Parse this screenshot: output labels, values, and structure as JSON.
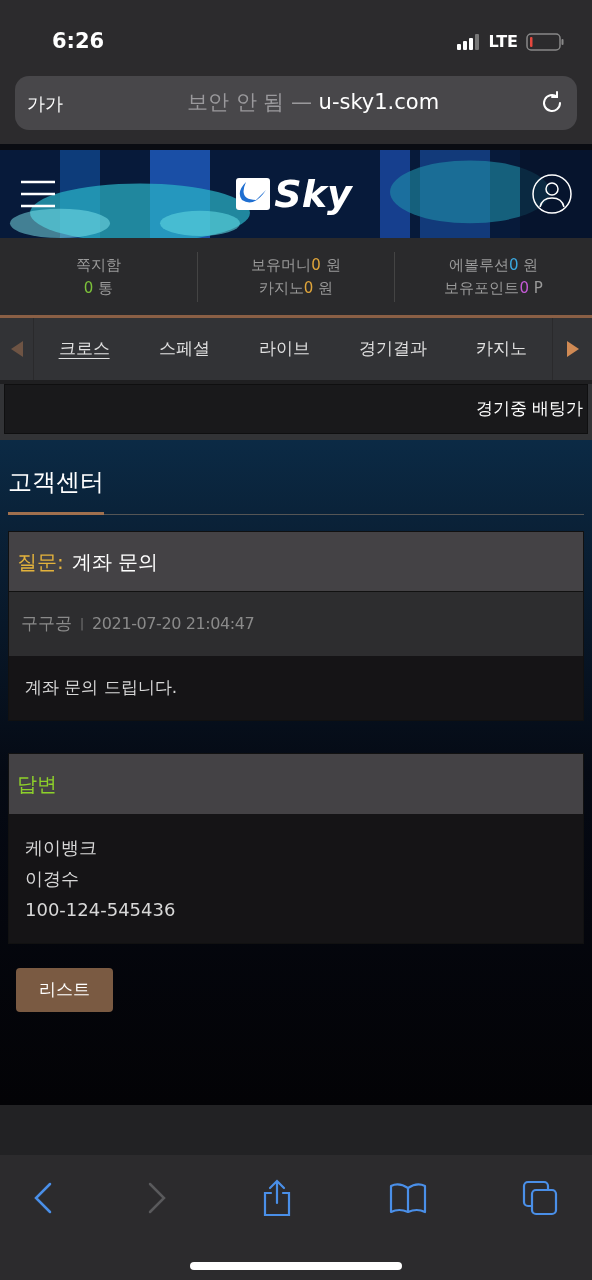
{
  "status_bar": {
    "time": "6:26",
    "network": "LTE"
  },
  "address_bar": {
    "text_size": "가가",
    "security": "보안 안 됨 —",
    "domain": "u-sky1.com"
  },
  "header": {
    "logo": "Sky"
  },
  "stats": [
    {
      "label": "쪽지함",
      "lines": [
        {
          "value": "0",
          "unit": "통",
          "color": "#7cc13a"
        }
      ]
    },
    {
      "lines": [
        {
          "name": "보유머니",
          "value": "0",
          "unit": "원",
          "color": "#e0a53a"
        },
        {
          "name": "카지노",
          "value": "0",
          "unit": "원",
          "color": "#e0a53a"
        }
      ]
    },
    {
      "lines": [
        {
          "name": "에볼루션",
          "value": "0",
          "unit": "원",
          "color": "#3aa8e0"
        },
        {
          "name": "보유포인트",
          "value": "0",
          "unit": "P",
          "color": "#c45ad6"
        }
      ]
    }
  ],
  "nav": {
    "tabs": [
      {
        "label": "크로스",
        "selected": true
      },
      {
        "label": "스페셜",
        "selected": false
      },
      {
        "label": "라이브",
        "selected": false
      },
      {
        "label": "경기결과",
        "selected": false
      },
      {
        "label": "카지노",
        "selected": false
      }
    ]
  },
  "ticker": "경기중 배팅가",
  "page_title": "고객센터",
  "question": {
    "label": "질문:",
    "title": "계좌 문의",
    "author": "구구공",
    "separator": "|",
    "date": "2021-07-20 21:04:47",
    "body": "계좌 문의 드립니다."
  },
  "answer": {
    "label": "답변",
    "lines": [
      "케이뱅크",
      "이경수",
      "100-124-545436"
    ]
  },
  "list_button": "리스트",
  "toolbar": {
    "back_disabled": false,
    "forward_disabled": true
  }
}
